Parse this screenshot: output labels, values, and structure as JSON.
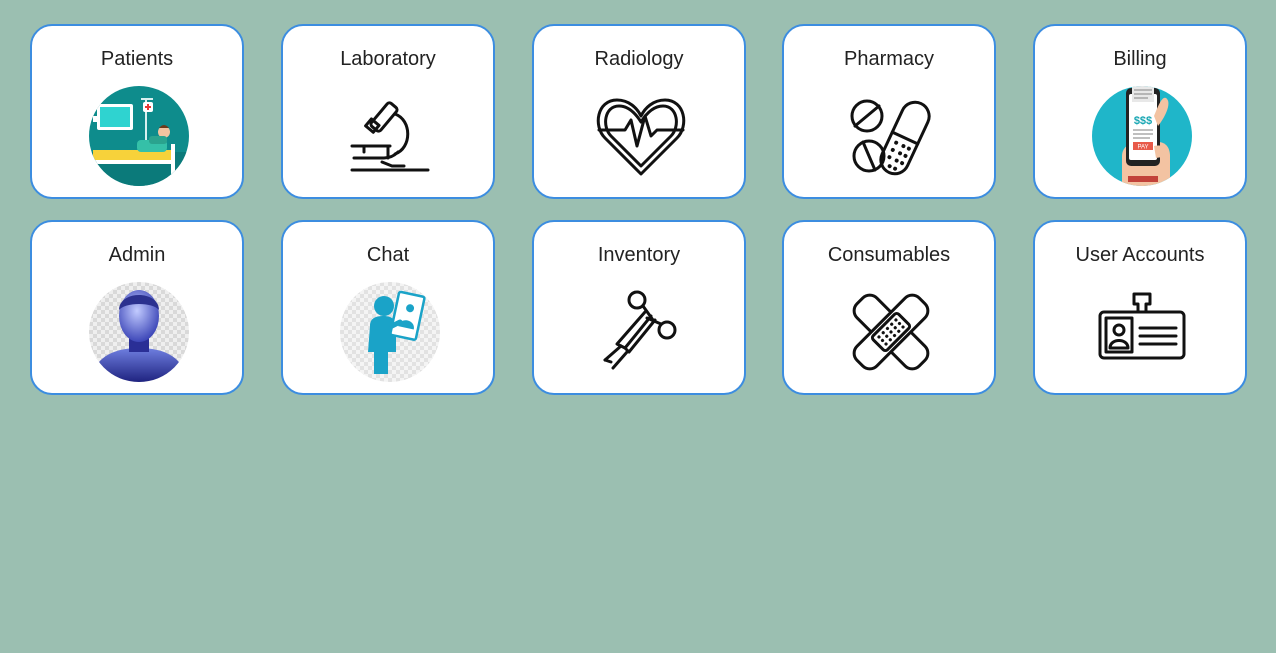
{
  "tiles": [
    {
      "label": "Patients",
      "icon": "patient-bed-icon"
    },
    {
      "label": "Laboratory",
      "icon": "microscope-icon"
    },
    {
      "label": "Radiology",
      "icon": "heart-pulse-icon"
    },
    {
      "label": "Pharmacy",
      "icon": "pills-icon"
    },
    {
      "label": "Billing",
      "icon": "phone-pay-icon"
    },
    {
      "label": "Admin",
      "icon": "admin-avatar-icon"
    },
    {
      "label": "Chat",
      "icon": "chat-person-icon"
    },
    {
      "label": "Inventory",
      "icon": "scissors-icon"
    },
    {
      "label": "Consumables",
      "icon": "bandage-icon"
    },
    {
      "label": "User Accounts",
      "icon": "id-card-icon"
    }
  ],
  "colors": {
    "background": "#9bbfb1",
    "tile_border": "#3c8de0",
    "tile_fill": "#ffffff",
    "accent_teal": "#17a6b3"
  }
}
